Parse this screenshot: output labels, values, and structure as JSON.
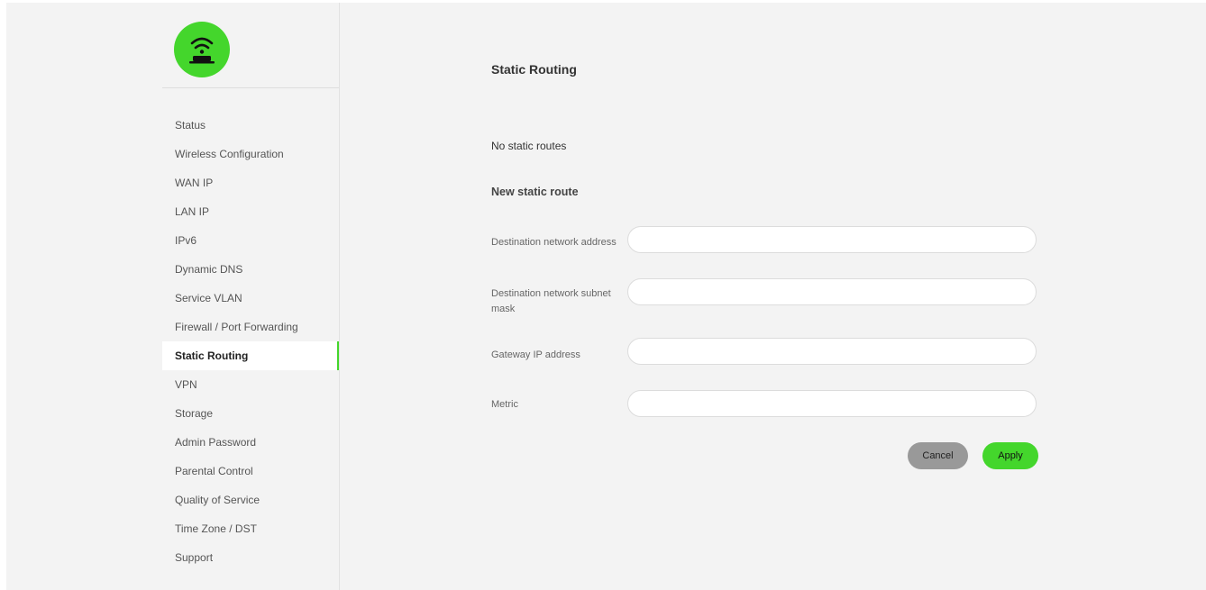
{
  "colors": {
    "accent": "#44d62c",
    "background": "#f3f3f3",
    "cancel": "#999999"
  },
  "logo": {
    "icon": "wifi-router-icon"
  },
  "nav": {
    "items": [
      {
        "label": "Status"
      },
      {
        "label": "Wireless Configuration"
      },
      {
        "label": "WAN IP"
      },
      {
        "label": "LAN IP"
      },
      {
        "label": "IPv6"
      },
      {
        "label": "Dynamic DNS"
      },
      {
        "label": "Service VLAN"
      },
      {
        "label": "Firewall / Port Forwarding"
      },
      {
        "label": "Static Routing",
        "active": true
      },
      {
        "label": "VPN"
      },
      {
        "label": "Storage"
      },
      {
        "label": "Admin Password"
      },
      {
        "label": "Parental Control"
      },
      {
        "label": "Quality of Service"
      },
      {
        "label": "Time Zone / DST"
      },
      {
        "label": "Support"
      }
    ]
  },
  "main": {
    "title": "Static Routing",
    "empty_text": "No static routes",
    "new_route_title": "New static route",
    "fields": {
      "destination_address": {
        "label": "Destination network address",
        "value": "",
        "placeholder": ""
      },
      "subnet_mask": {
        "label": "Destination network subnet mask",
        "value": "",
        "placeholder": ""
      },
      "gateway": {
        "label": "Gateway IP address",
        "value": "",
        "placeholder": ""
      },
      "metric": {
        "label": "Metric",
        "value": "",
        "placeholder": ""
      }
    },
    "buttons": {
      "cancel": "Cancel",
      "apply": "Apply"
    }
  }
}
